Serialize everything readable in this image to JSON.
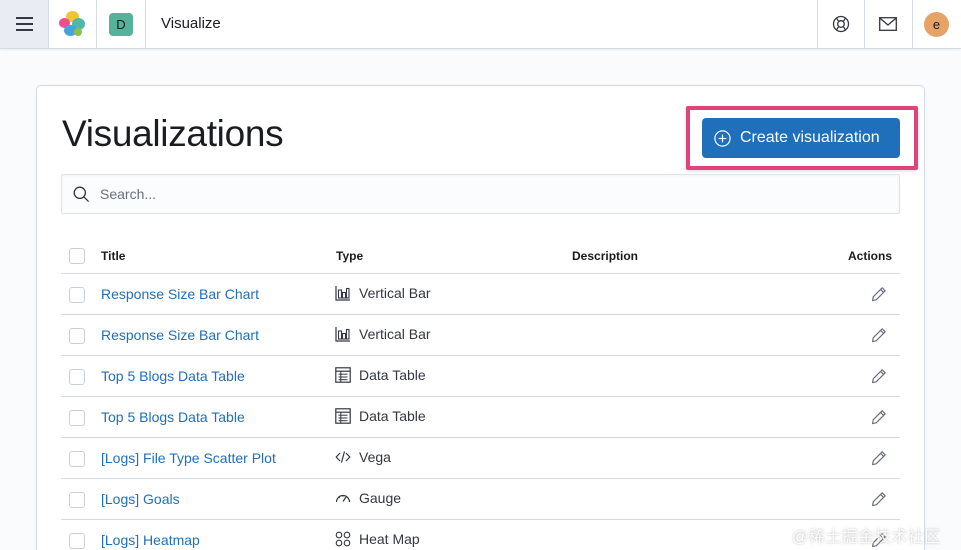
{
  "header": {
    "space_initial": "D",
    "app_title": "Visualize",
    "user_initial": "e",
    "icons": [
      "menu-icon",
      "elastic-logo-icon",
      "help-icon",
      "mail-icon"
    ]
  },
  "main": {
    "title": "Visualizations",
    "create_button": "Create visualization",
    "search_placeholder": "Search...",
    "columns": {
      "title": "Title",
      "type": "Type",
      "description": "Description",
      "actions": "Actions"
    },
    "rows": [
      {
        "title": "Response Size Bar Chart",
        "type": "Vertical Bar",
        "type_icon": "vertical-bar-icon",
        "description": ""
      },
      {
        "title": "Response Size Bar Chart",
        "type": "Vertical Bar",
        "type_icon": "vertical-bar-icon",
        "description": ""
      },
      {
        "title": "Top 5 Blogs Data Table",
        "type": "Data Table",
        "type_icon": "data-table-icon",
        "description": ""
      },
      {
        "title": "Top 5 Blogs Data Table",
        "type": "Data Table",
        "type_icon": "data-table-icon",
        "description": ""
      },
      {
        "title": "[Logs] File Type Scatter Plot",
        "type": "Vega",
        "type_icon": "vega-code-icon",
        "description": ""
      },
      {
        "title": "[Logs] Goals",
        "type": "Gauge",
        "type_icon": "gauge-icon",
        "description": ""
      },
      {
        "title": "[Logs] Heatmap",
        "type": "Heat Map",
        "type_icon": "heatmap-icon",
        "description": ""
      }
    ]
  },
  "watermark": "@稀土掘金技术社区",
  "colors": {
    "accent": "#1f6fba",
    "highlight": "#e0427c",
    "space_avatar": "#54b399",
    "user_avatar": "#e7a267"
  }
}
